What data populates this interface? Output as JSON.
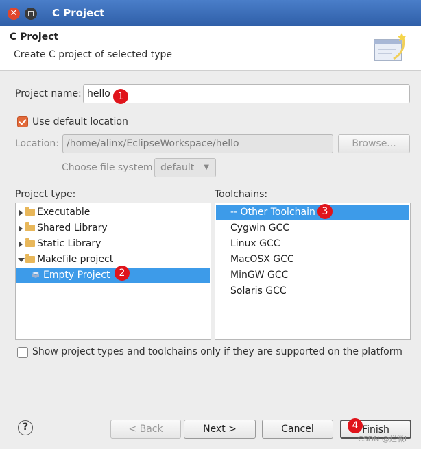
{
  "window": {
    "title": "C Project"
  },
  "header": {
    "title": "C Project",
    "description": "Create C project of selected type"
  },
  "project_name": {
    "label": "Project name:",
    "value": "hello"
  },
  "default_location": {
    "label": "Use default location",
    "checked": true
  },
  "location": {
    "label": "Location:",
    "value": "/home/alinx/EclipseWorkspace/hello",
    "browse_label": "Browse..."
  },
  "file_system": {
    "label": "Choose file system:",
    "value": "default"
  },
  "project_type": {
    "label": "Project type:",
    "items": [
      {
        "label": "Executable",
        "state": "collapsed"
      },
      {
        "label": "Shared Library",
        "state": "collapsed"
      },
      {
        "label": "Static Library",
        "state": "collapsed"
      },
      {
        "label": "Makefile project",
        "state": "expanded"
      },
      {
        "label": "Empty Project",
        "state": "selected"
      }
    ]
  },
  "toolchains": {
    "label": "Toolchains:",
    "items": [
      "-- Other Toolchain --",
      "Cygwin GCC",
      "Linux GCC",
      "MacOSX GCC",
      "MinGW GCC",
      "Solaris GCC"
    ],
    "selected": "-- Other Toolchain --"
  },
  "filter": {
    "label": "Show project types and toolchains only if they are supported on the platform",
    "checked": false
  },
  "buttons": {
    "help": "?",
    "back": "< Back",
    "next": "Next >",
    "cancel": "Cancel",
    "finish": "Finish"
  },
  "annotations": [
    "1",
    "2",
    "3",
    "4"
  ],
  "watermark": "CSDN @烂微I",
  "colors": {
    "titlebar": "#2f5fa8",
    "selection": "#3d9be9",
    "checkbox_accent": "#e26a3a",
    "badge": "#e0141b"
  }
}
